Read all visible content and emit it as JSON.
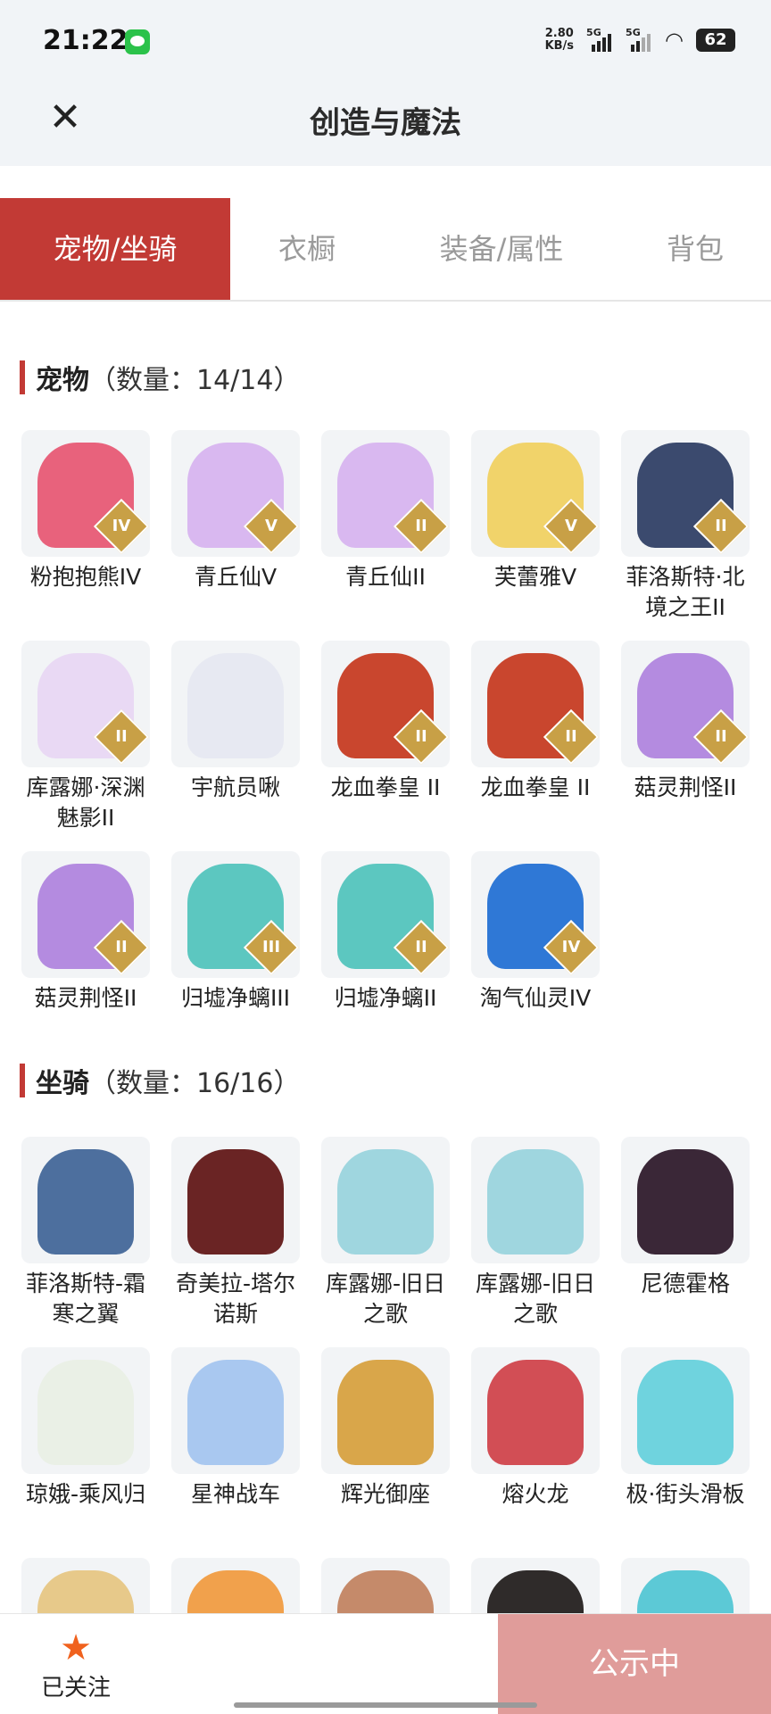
{
  "status_bar": {
    "time": "21:22",
    "net_speed_value": "2.80",
    "net_speed_unit": "KB/s",
    "signal1": "5G",
    "signal2": "5G",
    "battery": "62",
    "icons": [
      "wechat-icon",
      "signal-icon",
      "wifi-icon",
      "battery-icon"
    ]
  },
  "header": {
    "title": "创造与魔法",
    "close_icon": "close-icon"
  },
  "tabs": [
    {
      "label": "宠物/坐骑",
      "active": true
    },
    {
      "label": "衣橱",
      "active": false
    },
    {
      "label": "装备/属性",
      "active": false
    },
    {
      "label": "背包",
      "active": false
    }
  ],
  "sections": [
    {
      "name": "宠物",
      "count": "（数量：14/14）",
      "items": [
        {
          "label": "粉抱抱熊IV",
          "badge": "IV",
          "color": "#e8627c"
        },
        {
          "label": "青丘仙V",
          "badge": "V",
          "color": "#d9b8f0"
        },
        {
          "label": "青丘仙II",
          "badge": "II",
          "color": "#d9b8f0"
        },
        {
          "label": "芙蕾雅V",
          "badge": "V",
          "color": "#f1d36a"
        },
        {
          "label": "菲洛斯特·北境之王II",
          "badge": "II",
          "color": "#3b4a6e"
        },
        {
          "label": "库露娜·深渊魅影II",
          "badge": "II",
          "color": "#e9d9f4"
        },
        {
          "label": "宇航员啾",
          "badge": "",
          "color": "#e7e9f2"
        },
        {
          "label": "龙血拳皇 II",
          "badge": "II",
          "color": "#c9462e"
        },
        {
          "label": "龙血拳皇 II",
          "badge": "II",
          "color": "#c9462e"
        },
        {
          "label": "菇灵荆怪II",
          "badge": "II",
          "color": "#b48be0"
        },
        {
          "label": "菇灵荆怪II",
          "badge": "II",
          "color": "#b48be0"
        },
        {
          "label": "归墟净螭III",
          "badge": "III",
          "color": "#5cc7c0"
        },
        {
          "label": "归墟净螭II",
          "badge": "II",
          "color": "#5cc7c0"
        },
        {
          "label": "淘气仙灵IV",
          "badge": "IV",
          "color": "#2f78d6"
        }
      ]
    },
    {
      "name": "坐骑",
      "count": "（数量：16/16）",
      "items": [
        {
          "label": "菲洛斯特-霜寒之翼",
          "badge": "",
          "color": "#4d6f9e"
        },
        {
          "label": "奇美拉-塔尔诺斯",
          "badge": "",
          "color": "#6a2424"
        },
        {
          "label": "库露娜-旧日之歌",
          "badge": "",
          "color": "#9fd6df"
        },
        {
          "label": "库露娜-旧日之歌",
          "badge": "",
          "color": "#9fd6df"
        },
        {
          "label": "尼德霍格",
          "badge": "",
          "color": "#3a2737"
        },
        {
          "label": "琼娥-乘风归",
          "badge": "",
          "color": "#eaf0e6"
        },
        {
          "label": "星神战车",
          "badge": "",
          "color": "#a9c8f0"
        },
        {
          "label": "辉光御座",
          "badge": "",
          "color": "#d9a64a"
        },
        {
          "label": "熔火龙",
          "badge": "",
          "color": "#d24e55"
        },
        {
          "label": "极·街头滑板",
          "badge": "",
          "color": "#6fd3de"
        },
        {
          "label": "",
          "badge": "",
          "color": "#e7c98a"
        },
        {
          "label": "",
          "badge": "",
          "color": "#f1a14c"
        },
        {
          "label": "",
          "badge": "",
          "color": "#c58a6a"
        },
        {
          "label": "",
          "badge": "",
          "color": "#2f2b2a"
        },
        {
          "label": "",
          "badge": "",
          "color": "#5cc9d6"
        }
      ]
    }
  ],
  "bottom_bar": {
    "follow_label": "已关注",
    "follow_icon": "star-icon",
    "public_label": "公示中"
  }
}
